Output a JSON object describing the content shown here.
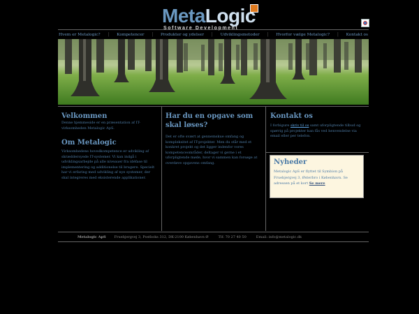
{
  "logo": {
    "metal": "Meta",
    "logic": "Logic",
    "tagline": "Software Development"
  },
  "nav": [
    "Hvem er Metalogic?",
    "Kompetencer",
    "Produkter og ydelser",
    "Udviklingsmetoder",
    "Hvorfor vælge Metalogic?",
    "Kontakt os"
  ],
  "col1": {
    "title": "Velkommen",
    "text": "Denne hjemmeside er en præsentation af IT-virksomheden Metalogic ApS.",
    "title2": "Om Metalogic",
    "text2": "Virksomhedens hovedkompetence er udvikling af skræddersyede IT-systemer. Vi kan indgå i udviklingsarbejde på alle niveauer fra idéfase til implementering og additionelse til brugere. Specielt har vi erfaring med udvikling af nye systemer, der skal integreres med eksisterende applikationer."
  },
  "col2": {
    "title": "Har du en opgave som skal løses?",
    "text": "Det er ofte svært at gennemskue omfang og kompleksitet af IT-projekter. Men du står med et konkret projekt og det ligger indenfor vores kompetenceområder, deltager vi gerne i et uforpligtende møde, hvor vi sammen kan forsøge at overdøve opgavens omfang."
  },
  "col3": {
    "title": "Kontakt os",
    "text_before": "I forbigure ",
    "link": "skriv til os",
    "text_after": " samt uforpligtende tilbud og spørrig på projekter kan fås ved henvendelse via email eller per telefon."
  },
  "news": {
    "title": "Nyheder",
    "text": "Metalogic ApS er flyttet til Symbion på Fruebjergvej 3, Østerbro i København. Se adressen på et kort ",
    "more": "Se mere"
  },
  "footer": {
    "company": "Metalogic ApS",
    "address": "Fruebjergvej 3, Postboks 312, DK-2100 København Ø",
    "phone": "Tlf: 70 27 40 50",
    "email": "Email: info@metalogic.dk"
  }
}
